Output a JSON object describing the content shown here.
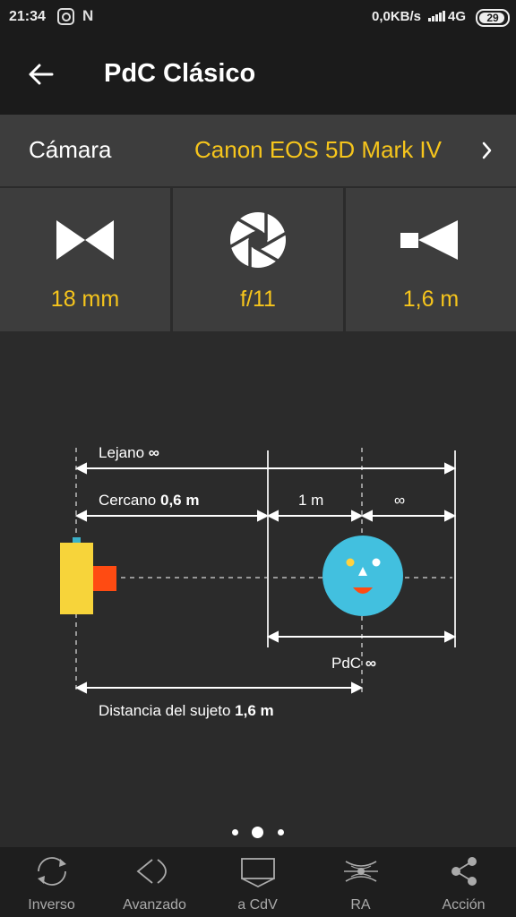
{
  "status_bar": {
    "time": "21:34",
    "net_speed": "0,0KB/s",
    "network": "4G",
    "battery": "29"
  },
  "app_bar": {
    "title": "PdC Clásico",
    "back_icon": "arrow-left-icon"
  },
  "camera": {
    "label": "Cámara",
    "value": "Canon EOS 5D Mark IV"
  },
  "params": [
    {
      "icon": "focal-length-icon",
      "value": "18 mm"
    },
    {
      "icon": "aperture-icon",
      "value": "f/11"
    },
    {
      "icon": "distance-icon",
      "value": "1,6 m"
    }
  ],
  "diagram": {
    "far_label": "Lejano",
    "far_value": "∞",
    "near_label": "Cercano",
    "near_value": "0,6 m",
    "segment_1": "1 m",
    "segment_2": "∞",
    "dof_label": "PdC",
    "dof_value": "∞",
    "subject_label": "Distancia del sujeto",
    "subject_value": "1,6 m"
  },
  "pager": {
    "pages": 3,
    "active": 2
  },
  "bottom_nav": [
    {
      "icon": "rotate-icon",
      "label": "Inverso"
    },
    {
      "icon": "eye-icon",
      "label": "Avanzado"
    },
    {
      "icon": "screen-icon",
      "label": "a CdV"
    },
    {
      "icon": "ar-icon",
      "label": "RA"
    },
    {
      "icon": "share-icon",
      "label": "Acción"
    }
  ],
  "colors": {
    "accent": "#f6c51c",
    "camera_body": "#f7d43a",
    "lens": "#ff4b12",
    "face": "#42c0df",
    "background": "#2b2b2b"
  }
}
